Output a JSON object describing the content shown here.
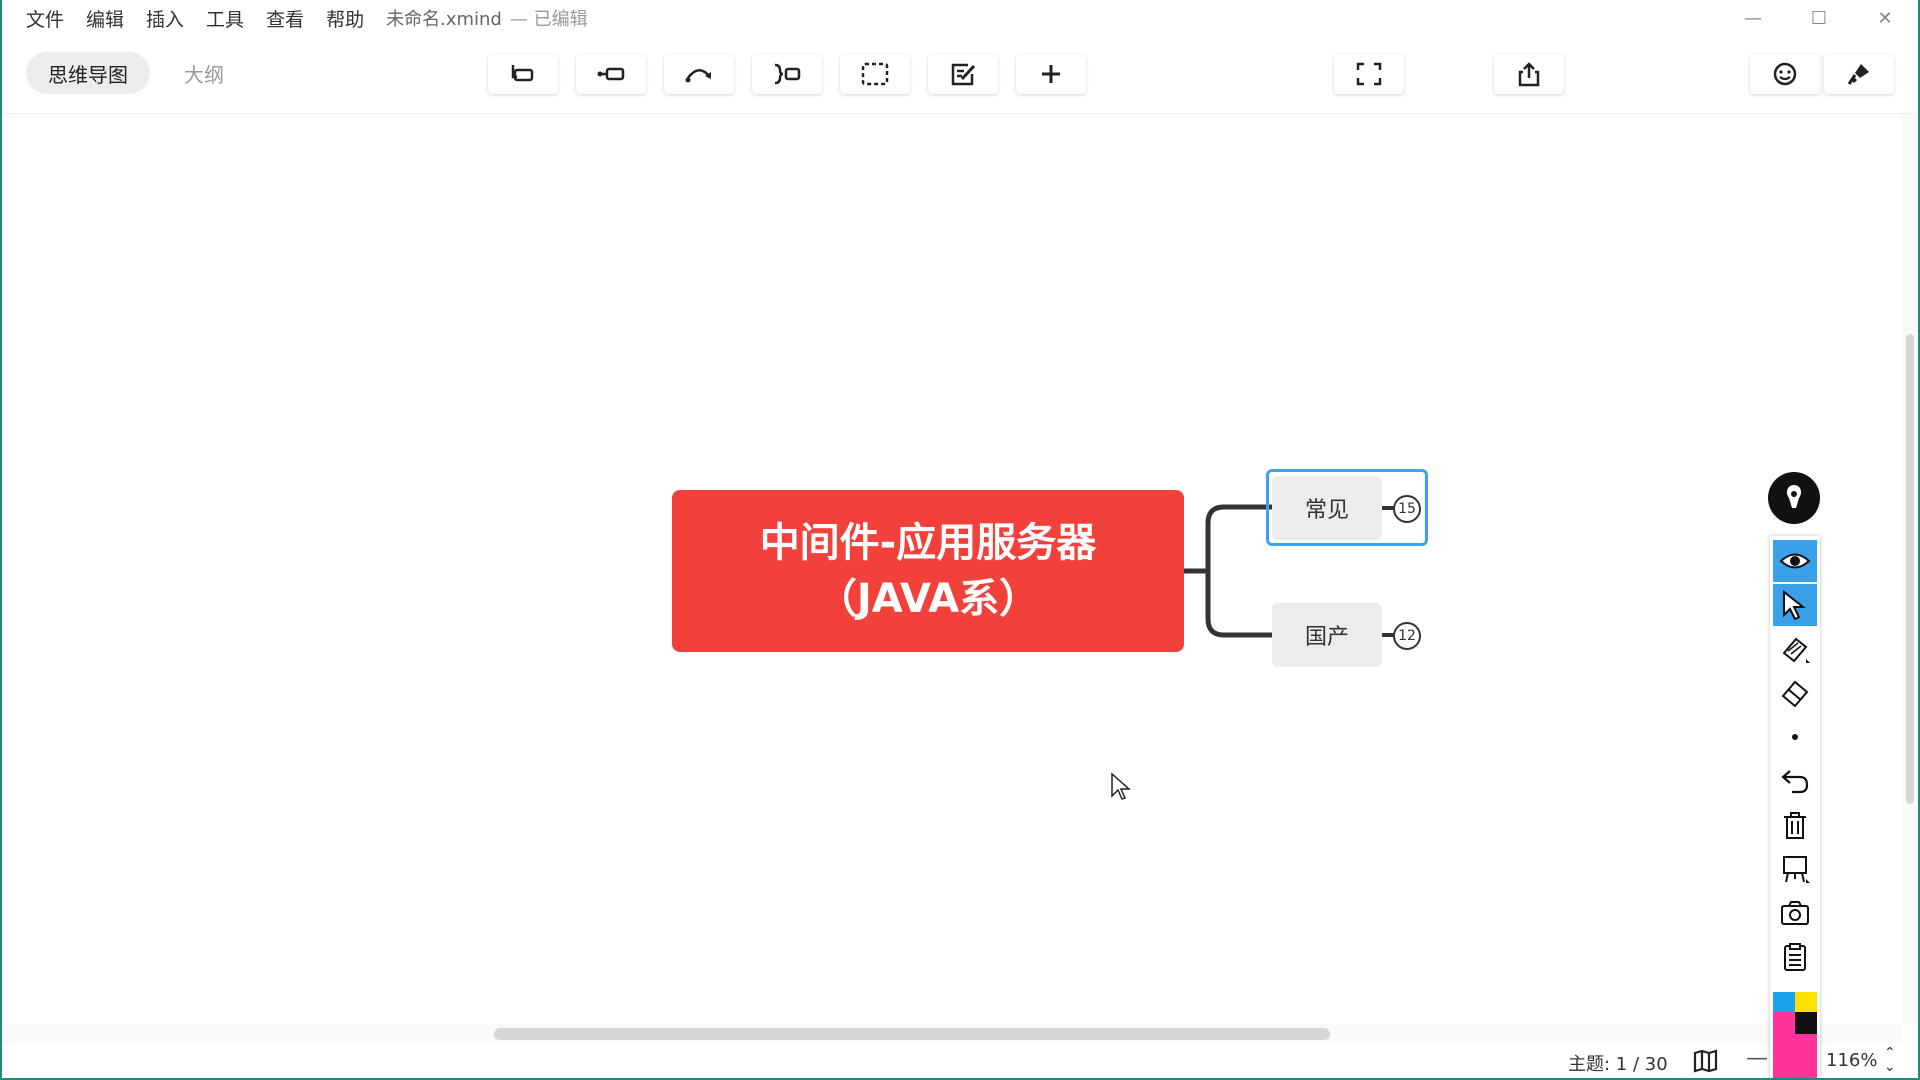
{
  "menu": {
    "items": [
      "文件",
      "编辑",
      "插入",
      "工具",
      "查看",
      "帮助"
    ],
    "doc_title": "未命名.xmind",
    "doc_status": "— 已编辑"
  },
  "window_controls": {
    "minimize": "—",
    "maximize": "☐",
    "close": "✕"
  },
  "toolbar": {
    "tab_mindmap": "思维导图",
    "tab_outline": "大纲",
    "tools": [
      "insert-topic-icon",
      "insert-subtopic-icon",
      "relationship-icon",
      "summary-icon",
      "boundary-icon",
      "note-icon",
      "add-icon",
      "fullscreen-icon",
      "share-icon",
      "emoji-icon",
      "format-icon"
    ]
  },
  "mindmap": {
    "central_topic": "中间件-应用服务器（JAVA系）",
    "central_color": "#f2413b",
    "topics": [
      {
        "label": "常见",
        "count": "15",
        "selected": true
      },
      {
        "label": "国产",
        "count": "12",
        "selected": false
      }
    ],
    "selection_color": "#3ba3f0"
  },
  "status": {
    "topics_label": "主题: 1 / 30",
    "zoom_minus": "—",
    "zoom_value": "116%"
  },
  "pen_toolbar": {
    "tools": [
      "eye-icon",
      "pointer-icon",
      "pen-icon",
      "eraser-icon",
      "dot-icon",
      "undo-icon",
      "trash-icon",
      "whiteboard-icon",
      "camera-icon",
      "clipboard-icon"
    ],
    "colors": [
      "#1aa3e8",
      "#ffe100",
      "#ff3399",
      "#111111"
    ]
  }
}
